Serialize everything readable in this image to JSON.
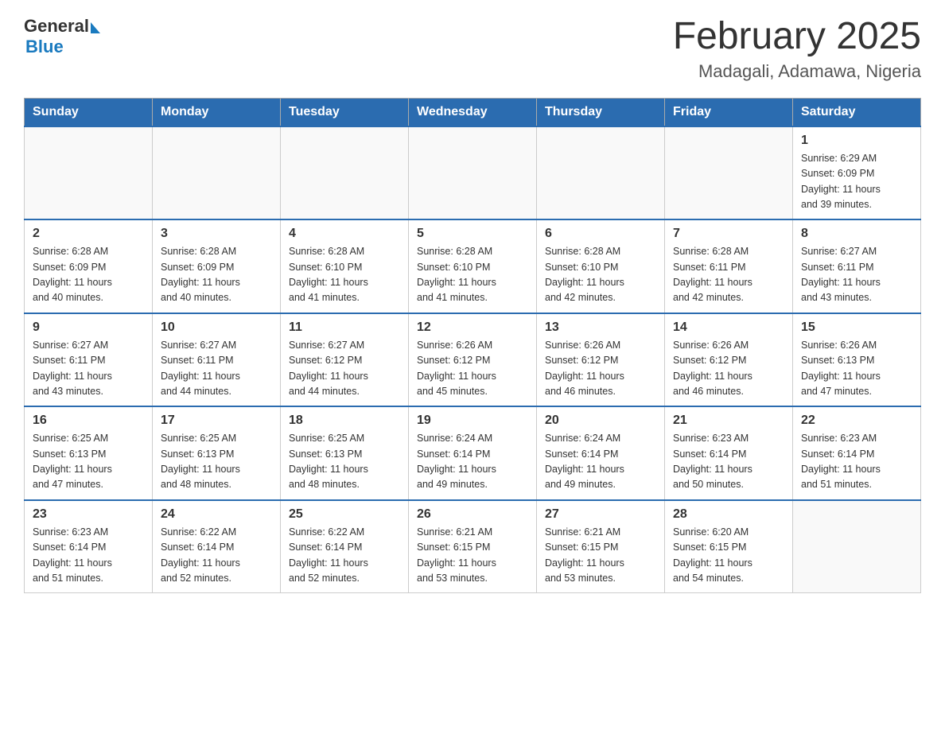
{
  "header": {
    "logo_general": "General",
    "logo_blue": "Blue",
    "title": "February 2025",
    "location": "Madagali, Adamawa, Nigeria"
  },
  "calendar": {
    "days_of_week": [
      "Sunday",
      "Monday",
      "Tuesday",
      "Wednesday",
      "Thursday",
      "Friday",
      "Saturday"
    ],
    "weeks": [
      [
        {
          "date": "",
          "info": ""
        },
        {
          "date": "",
          "info": ""
        },
        {
          "date": "",
          "info": ""
        },
        {
          "date": "",
          "info": ""
        },
        {
          "date": "",
          "info": ""
        },
        {
          "date": "",
          "info": ""
        },
        {
          "date": "1",
          "info": "Sunrise: 6:29 AM\nSunset: 6:09 PM\nDaylight: 11 hours\nand 39 minutes."
        }
      ],
      [
        {
          "date": "2",
          "info": "Sunrise: 6:28 AM\nSunset: 6:09 PM\nDaylight: 11 hours\nand 40 minutes."
        },
        {
          "date": "3",
          "info": "Sunrise: 6:28 AM\nSunset: 6:09 PM\nDaylight: 11 hours\nand 40 minutes."
        },
        {
          "date": "4",
          "info": "Sunrise: 6:28 AM\nSunset: 6:10 PM\nDaylight: 11 hours\nand 41 minutes."
        },
        {
          "date": "5",
          "info": "Sunrise: 6:28 AM\nSunset: 6:10 PM\nDaylight: 11 hours\nand 41 minutes."
        },
        {
          "date": "6",
          "info": "Sunrise: 6:28 AM\nSunset: 6:10 PM\nDaylight: 11 hours\nand 42 minutes."
        },
        {
          "date": "7",
          "info": "Sunrise: 6:28 AM\nSunset: 6:11 PM\nDaylight: 11 hours\nand 42 minutes."
        },
        {
          "date": "8",
          "info": "Sunrise: 6:27 AM\nSunset: 6:11 PM\nDaylight: 11 hours\nand 43 minutes."
        }
      ],
      [
        {
          "date": "9",
          "info": "Sunrise: 6:27 AM\nSunset: 6:11 PM\nDaylight: 11 hours\nand 43 minutes."
        },
        {
          "date": "10",
          "info": "Sunrise: 6:27 AM\nSunset: 6:11 PM\nDaylight: 11 hours\nand 44 minutes."
        },
        {
          "date": "11",
          "info": "Sunrise: 6:27 AM\nSunset: 6:12 PM\nDaylight: 11 hours\nand 44 minutes."
        },
        {
          "date": "12",
          "info": "Sunrise: 6:26 AM\nSunset: 6:12 PM\nDaylight: 11 hours\nand 45 minutes."
        },
        {
          "date": "13",
          "info": "Sunrise: 6:26 AM\nSunset: 6:12 PM\nDaylight: 11 hours\nand 46 minutes."
        },
        {
          "date": "14",
          "info": "Sunrise: 6:26 AM\nSunset: 6:12 PM\nDaylight: 11 hours\nand 46 minutes."
        },
        {
          "date": "15",
          "info": "Sunrise: 6:26 AM\nSunset: 6:13 PM\nDaylight: 11 hours\nand 47 minutes."
        }
      ],
      [
        {
          "date": "16",
          "info": "Sunrise: 6:25 AM\nSunset: 6:13 PM\nDaylight: 11 hours\nand 47 minutes."
        },
        {
          "date": "17",
          "info": "Sunrise: 6:25 AM\nSunset: 6:13 PM\nDaylight: 11 hours\nand 48 minutes."
        },
        {
          "date": "18",
          "info": "Sunrise: 6:25 AM\nSunset: 6:13 PM\nDaylight: 11 hours\nand 48 minutes."
        },
        {
          "date": "19",
          "info": "Sunrise: 6:24 AM\nSunset: 6:14 PM\nDaylight: 11 hours\nand 49 minutes."
        },
        {
          "date": "20",
          "info": "Sunrise: 6:24 AM\nSunset: 6:14 PM\nDaylight: 11 hours\nand 49 minutes."
        },
        {
          "date": "21",
          "info": "Sunrise: 6:23 AM\nSunset: 6:14 PM\nDaylight: 11 hours\nand 50 minutes."
        },
        {
          "date": "22",
          "info": "Sunrise: 6:23 AM\nSunset: 6:14 PM\nDaylight: 11 hours\nand 51 minutes."
        }
      ],
      [
        {
          "date": "23",
          "info": "Sunrise: 6:23 AM\nSunset: 6:14 PM\nDaylight: 11 hours\nand 51 minutes."
        },
        {
          "date": "24",
          "info": "Sunrise: 6:22 AM\nSunset: 6:14 PM\nDaylight: 11 hours\nand 52 minutes."
        },
        {
          "date": "25",
          "info": "Sunrise: 6:22 AM\nSunset: 6:14 PM\nDaylight: 11 hours\nand 52 minutes."
        },
        {
          "date": "26",
          "info": "Sunrise: 6:21 AM\nSunset: 6:15 PM\nDaylight: 11 hours\nand 53 minutes."
        },
        {
          "date": "27",
          "info": "Sunrise: 6:21 AM\nSunset: 6:15 PM\nDaylight: 11 hours\nand 53 minutes."
        },
        {
          "date": "28",
          "info": "Sunrise: 6:20 AM\nSunset: 6:15 PM\nDaylight: 11 hours\nand 54 minutes."
        },
        {
          "date": "",
          "info": ""
        }
      ]
    ]
  }
}
